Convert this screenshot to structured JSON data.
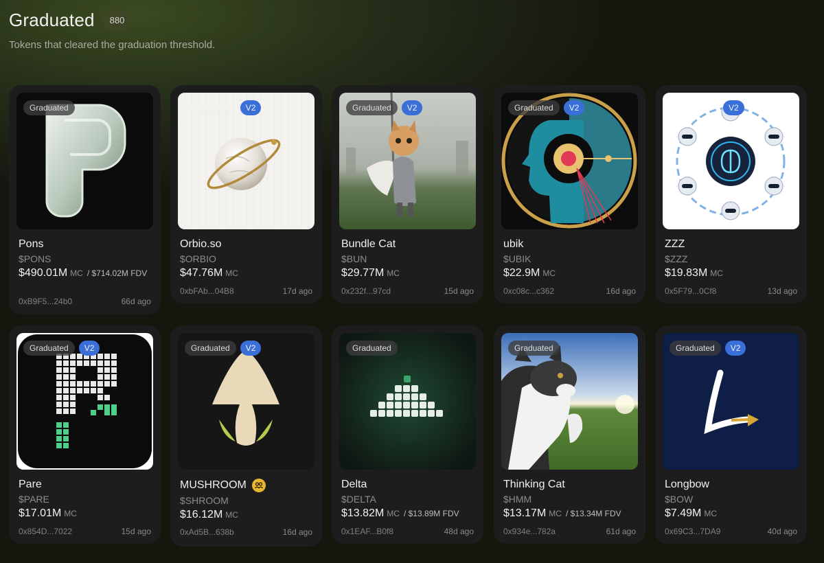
{
  "header": {
    "title": "Graduated",
    "count": "880",
    "subtitle": "Tokens that cleared the graduation threshold."
  },
  "badge_graduated": "Graduated",
  "badge_v2": "V2",
  "tokens": [
    {
      "name": "Pons",
      "ticker": "$PONS",
      "mc": "$490.01M",
      "mc_unit": "MC",
      "fdv": "/ $714.02M FDV",
      "address": "0xB9F5...24b0",
      "age": "66d ago"
    },
    {
      "name": "Orbio.so",
      "ticker": "$ORBIO",
      "mc": "$47.76M",
      "mc_unit": "MC",
      "fdv": "",
      "address": "0xbFAb...04B8",
      "age": "17d ago"
    },
    {
      "name": "Bundle Cat",
      "ticker": "$BUN",
      "mc": "$29.77M",
      "mc_unit": "MC",
      "fdv": "",
      "address": "0x232f...97cd",
      "age": "15d ago"
    },
    {
      "name": "ubik",
      "ticker": "$UBIK",
      "mc": "$22.9M",
      "mc_unit": "MC",
      "fdv": "",
      "address": "0xc08c...c362",
      "age": "16d ago"
    },
    {
      "name": "ZZZ",
      "ticker": "$ZZZ",
      "mc": "$19.83M",
      "mc_unit": "MC",
      "fdv": "",
      "address": "0x5F79...0Cf8",
      "age": "13d ago"
    },
    {
      "name": "Pare",
      "ticker": "$PARE",
      "mc": "$17.01M",
      "mc_unit": "MC",
      "fdv": "",
      "address": "0x854D...7022",
      "age": "15d ago"
    },
    {
      "name": "MUSHROOM",
      "ticker": "$SHROOM",
      "mc": "$16.12M",
      "mc_unit": "MC",
      "fdv": "",
      "address": "0xAd5B...638b",
      "age": "16d ago"
    },
    {
      "name": "Delta",
      "ticker": "$DELTA",
      "mc": "$13.82M",
      "mc_unit": "MC",
      "fdv": "/ $13.89M FDV",
      "address": "0x1EAF...B0f8",
      "age": "48d ago"
    },
    {
      "name": "Thinking Cat",
      "ticker": "$HMM",
      "mc": "$13.17M",
      "mc_unit": "MC",
      "fdv": "/ $13.34M FDV",
      "address": "0x934e...782a",
      "age": "61d ago"
    },
    {
      "name": "Longbow",
      "ticker": "$BOW",
      "mc": "$7.49M",
      "mc_unit": "MC",
      "fdv": "",
      "address": "0x69C3...7DA9",
      "age": "40d ago"
    }
  ],
  "icons": {
    "community": "community-icon"
  },
  "colors": {
    "v2_badge": "#3a6fd8",
    "community_badge": "#e8b530"
  }
}
